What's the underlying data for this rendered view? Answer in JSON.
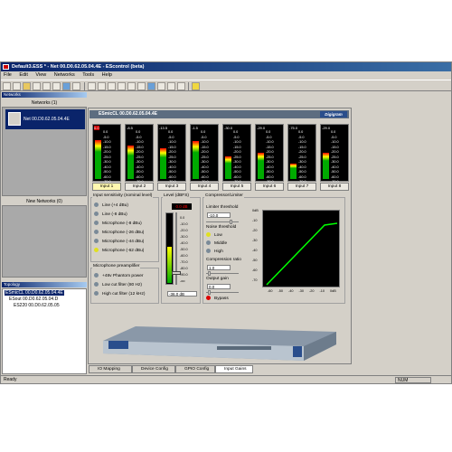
{
  "app": {
    "title": "Default3.ESS * - Net 00.D0.62.05.04.4E - EScontrol (beta)"
  },
  "menu": [
    "File",
    "Edit",
    "View",
    "Networks",
    "Tools",
    "Help"
  ],
  "left": {
    "networks_header": "Networks",
    "networks_label": "Networks (1)",
    "selected_network": "Net 00.D0.62.05.04.4E",
    "new_networks_label": "New Networks (0)",
    "topology_header": "Topology",
    "tree": [
      "ESmicCL 00.D0.62.05.04.4E",
      "ESout 00.D0.62.05.04.D",
      "ES220 00.D0.62.05.05"
    ]
  },
  "device_frame": {
    "title": "ESmicCL 00.D0.62.05.04.4E",
    "logo": "Digigram"
  },
  "meters": {
    "peaks": [
      "0.0",
      "-8.5",
      "-13.5",
      "-1.5",
      "-30.0",
      "-29.0",
      "-75.0",
      "-29.0"
    ],
    "levels": [
      0.72,
      0.62,
      0.56,
      0.7,
      0.42,
      0.48,
      0.28,
      0.48
    ],
    "scale": "0.0\n-5.0\n-10.0\n-15.0\n-20.0\n-25.0\n-30.0\n-40.0\n-50.0\n-60.0\n-70.0\n-oo"
  },
  "inputs": [
    "Input 1",
    "Input 2",
    "Input 3",
    "Input 4",
    "Input 5",
    "Input 6",
    "Input 7",
    "Input 8"
  ],
  "sensitivity": {
    "title": "Input sensitivity (nominal level)",
    "options": [
      "Line (+4 dBu)",
      "Line (-8 dBu)",
      "Microphone (-8 dBu)",
      "Microphone (-26 dBu)",
      "Microphone (-44 dBu)",
      "Microphone (-62 dBu)"
    ],
    "selected_index": 5
  },
  "preamp": {
    "title": "Microphone preamplifier",
    "options": [
      "+48v Phantom power",
      "Low cut filter (80 Hz)",
      "High cut filter (12 kHz)"
    ]
  },
  "level": {
    "title": "Level (dBFS)",
    "value": "0.0 dB",
    "fader_value": "-36.0 dB",
    "scale": "0.0\n-10.0\n-20.0\n-30.0\n-40.0\n-50.0\n-60.0\n-70.0\n-80.0\n-90.0\n-oo"
  },
  "compressor": {
    "title": "Compressor/Limiter",
    "limiter_label": "Limiter threshold",
    "limiter_value": "-10.0",
    "noise_label": "Noise threshold",
    "noise_options": [
      "Low",
      "Middle",
      "High"
    ],
    "noise_selected": 0,
    "ratio_label": "Compression ratio",
    "ratio_value": "1.0",
    "gain_label": "Output gain",
    "gain_value": "0.0",
    "bypass_label": "Bypass",
    "y_ticks": [
      "0dB",
      "-10",
      "-20",
      "-30",
      "-40",
      "-50",
      "-60",
      "-70"
    ],
    "x_ticks": [
      "-60",
      "-50",
      "-40",
      "-30",
      "-20",
      "-10",
      "0dB"
    ]
  },
  "tabs": [
    "IO Mapping",
    "Device Config",
    "GPIO Config",
    "Input Gains"
  ],
  "status": {
    "text": "Ready",
    "num": "NUM"
  },
  "colors": {
    "title_bar": "#0a246a",
    "meter_green": "#00aa00",
    "curve": "#00ff00",
    "selected_input": "#fff8b0"
  }
}
